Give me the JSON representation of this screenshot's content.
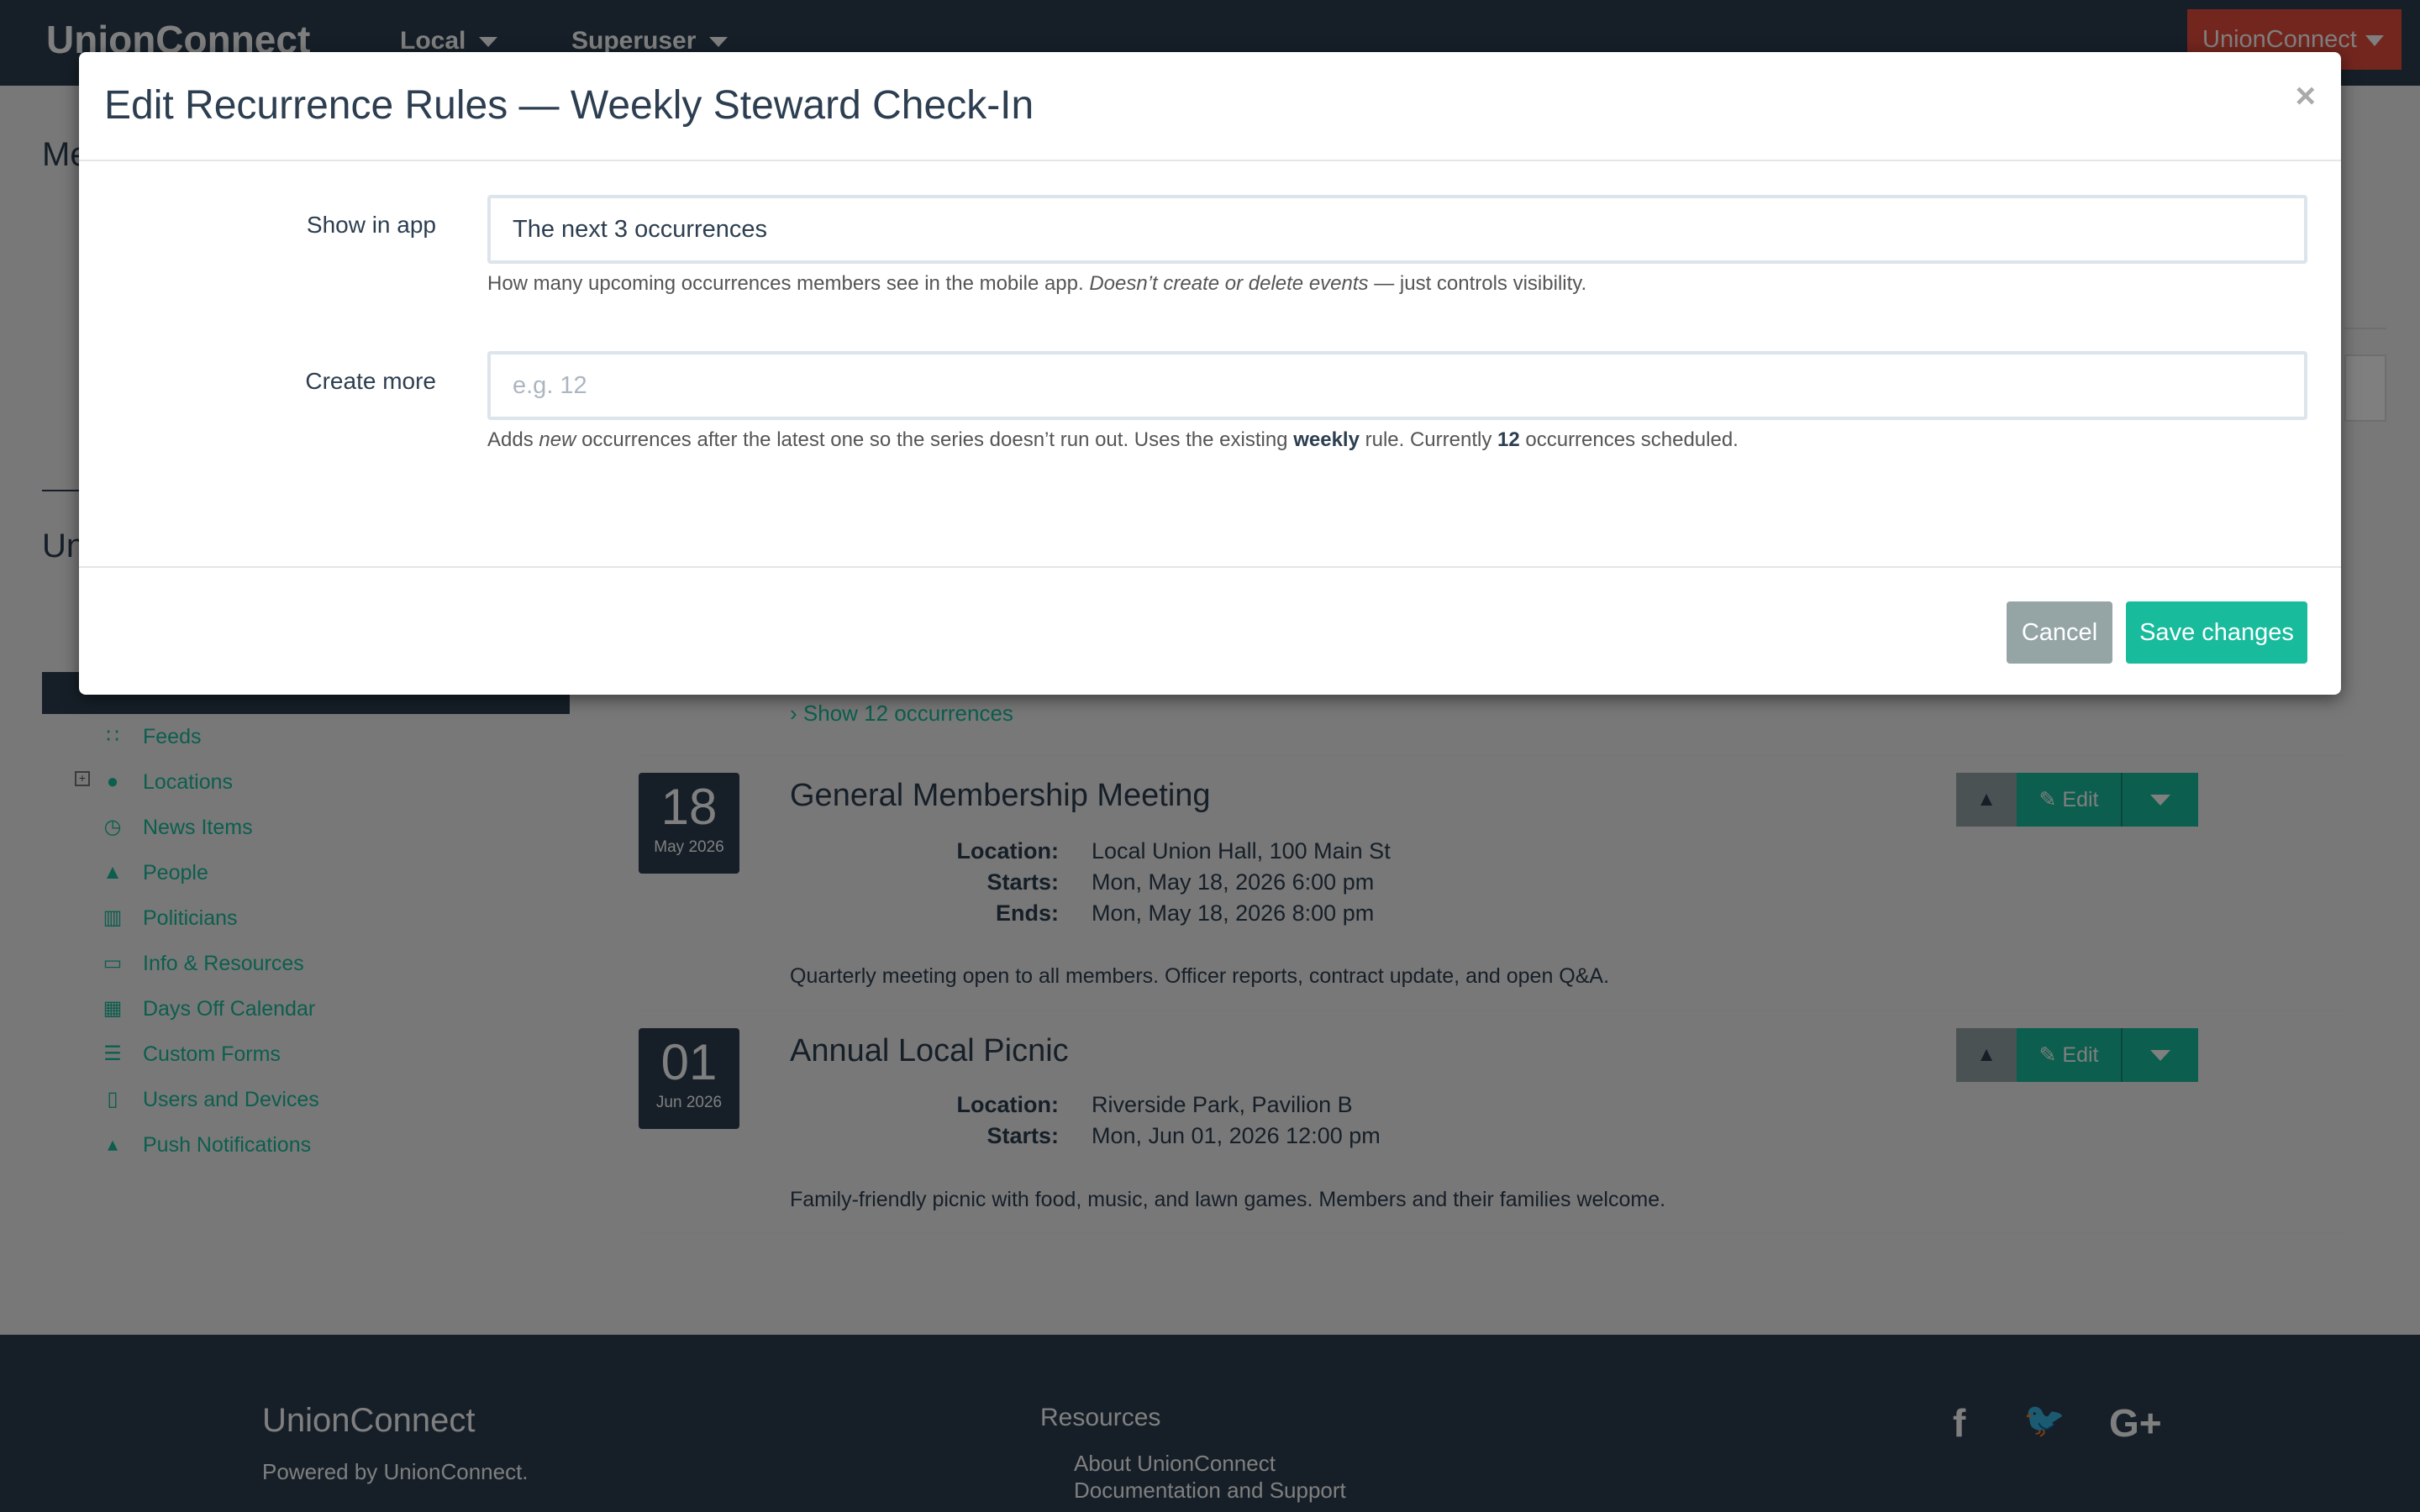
{
  "navbar": {
    "brand": "UnionConnect",
    "items": [
      {
        "label": "Local"
      },
      {
        "label": "Superuser"
      }
    ],
    "account_button": "UnionConnect"
  },
  "background": {
    "frag_me": "Me",
    "frag_un": "Un"
  },
  "sidebar": {
    "items": [
      {
        "label": "Feeds",
        "icon": "rss-icon"
      },
      {
        "label": "Locations",
        "icon": "globe-icon",
        "expandable": true
      },
      {
        "label": "News Items",
        "icon": "clock-icon"
      },
      {
        "label": "People",
        "icon": "user-icon"
      },
      {
        "label": "Politicians",
        "icon": "building-icon"
      },
      {
        "label": "Info & Resources",
        "icon": "folder-open-icon"
      },
      {
        "label": "Days Off Calendar",
        "icon": "calendar-icon"
      },
      {
        "label": "Custom Forms",
        "icon": "list-alt-icon"
      },
      {
        "label": "Users and Devices",
        "icon": "tablet-icon"
      },
      {
        "label": "Push Notifications",
        "icon": "bell-icon"
      }
    ]
  },
  "events": {
    "show_occurrences": "Show 12 occurrences",
    "edit_label": "Edit",
    "items": [
      {
        "day": "18",
        "month": "May 2026",
        "title": "General Membership Meeting",
        "rows": [
          {
            "key": "Location:",
            "value": "Local Union Hall, 100 Main St"
          },
          {
            "key": "Starts:",
            "value": "Mon, May 18, 2026 6:00 pm"
          },
          {
            "key": "Ends:",
            "value": "Mon, May 18, 2026 8:00 pm"
          }
        ],
        "description": "Quarterly meeting open to all members. Officer reports, contract update, and open Q&A."
      },
      {
        "day": "01",
        "month": "Jun 2026",
        "title": "Annual Local Picnic",
        "rows": [
          {
            "key": "Location:",
            "value": "Riverside Park, Pavilion B"
          },
          {
            "key": "Starts:",
            "value": "Mon, Jun 01, 2026 12:00 pm"
          }
        ],
        "description": "Family-friendly picnic with food, music, and lawn games. Members and their families welcome."
      }
    ]
  },
  "footer": {
    "brand": "UnionConnect",
    "powered": "Powered by UnionConnect.",
    "resources_title": "Resources",
    "links": [
      "About UnionConnect",
      "Documentation and Support"
    ],
    "social": [
      "f",
      "🐦",
      "G+"
    ]
  },
  "modal": {
    "title": "Edit Recurrence Rules — Weekly Steward Check-In",
    "close": "×",
    "show_in_app": {
      "label": "Show in app",
      "value": "The next 3 occurrences",
      "help_prefix": "How many upcoming occurrences members see in the mobile app. ",
      "help_em": "Doesn’t create or delete events",
      "help_suffix": " — just controls visibility."
    },
    "create_more": {
      "label": "Create more",
      "placeholder": "e.g. 12",
      "help_1": "Adds ",
      "help_em": "new",
      "help_2": " occurrences after the latest one so the series doesn’t run out. Uses the existing ",
      "help_b1": "weekly",
      "help_3": " rule. Currently ",
      "help_b2": "12",
      "help_4": " occurrences scheduled."
    },
    "cancel_label": "Cancel",
    "save_label": "Save changes"
  },
  "colors": {
    "primary": "#2c3e50",
    "success": "#18bc9c",
    "danger": "#e74c3c",
    "muted": "#95a5a6"
  }
}
